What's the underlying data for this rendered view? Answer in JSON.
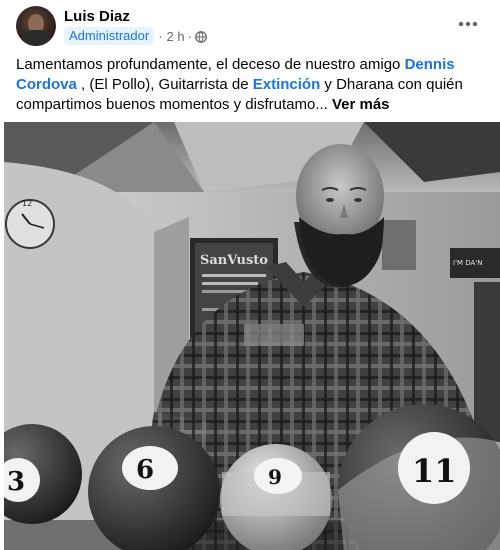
{
  "post": {
    "author": "Luis Diaz",
    "role_badge": "Administrador",
    "separator": "·",
    "time": "2 h",
    "time_dot": "·",
    "text": {
      "part1": "Lamentamos profundamente, el deceso de nuestro amigo ",
      "mention1": "Dennis Cordova",
      "part2": " , (El Pollo), Guitarrista de ",
      "mention2": "Extinción",
      "part3": " y Dharana  con quién compartimos buenos momentos y disfrutamo... ",
      "see_more": "Ver más"
    },
    "photo": {
      "poster_text": "SanVusto",
      "ball_numbers": [
        "3",
        "6",
        "9",
        "11"
      ],
      "clock_numeral": "12",
      "wall_sign": "I'M DA'N"
    }
  },
  "icons": {
    "more": "more-options-icon",
    "privacy": "globe-icon"
  },
  "colors": {
    "link": "#1b74e4",
    "badge_bg": "#e7f3ff",
    "meta_text": "#65676b"
  }
}
